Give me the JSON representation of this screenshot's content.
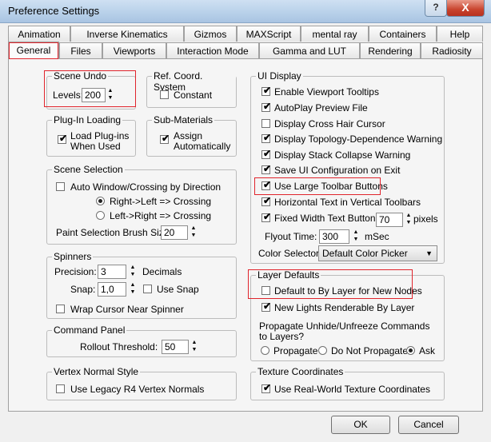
{
  "window": {
    "title": "Preference Settings",
    "help": "?",
    "close": "X"
  },
  "tabs_row1": [
    "Animation",
    "Inverse Kinematics",
    "Gizmos",
    "MAXScript",
    "mental ray",
    "Containers",
    "Help"
  ],
  "tabs_row2": [
    "General",
    "Files",
    "Viewports",
    "Interaction Mode",
    "Gamma and LUT",
    "Rendering",
    "Radiosity"
  ],
  "scene_undo": {
    "title": "Scene Undo",
    "levels_label": "Levels:",
    "levels_value": "200"
  },
  "ref_coord": {
    "title": "Ref. Coord. System",
    "constant": "Constant"
  },
  "plugin_loading": {
    "title": "Plug-In Loading",
    "load_line1": "Load Plug-ins",
    "load_line2": "When Used"
  },
  "sub_materials": {
    "title": "Sub-Materials",
    "assign_line1": "Assign",
    "assign_line2": "Automatically"
  },
  "scene_selection": {
    "title": "Scene Selection",
    "auto_window": "Auto Window/Crossing by Direction",
    "right_left": "Right->Left => Crossing",
    "left_right": "Left->Right => Crossing",
    "brush_label": "Paint Selection Brush Size",
    "brush_value": "20"
  },
  "spinners": {
    "title": "Spinners",
    "precision_label": "Precision:",
    "precision_value": "3",
    "decimals": "Decimals",
    "snap_label": "Snap:",
    "snap_value": "1,0",
    "use_snap": "Use Snap",
    "wrap_cursor": "Wrap Cursor Near Spinner"
  },
  "command_panel": {
    "title": "Command Panel",
    "rollout_label": "Rollout Threshold:",
    "rollout_value": "50"
  },
  "vertex_normal": {
    "title": "Vertex Normal Style",
    "legacy": "Use Legacy R4 Vertex Normals"
  },
  "ui_display": {
    "title": "UI Display",
    "items": [
      "Enable Viewport Tooltips",
      "AutoPlay Preview File",
      "Display Cross Hair Cursor",
      "Display Topology-Dependence Warning",
      "Display Stack Collapse Warning",
      "Save UI Configuration on Exit",
      "Use Large Toolbar Buttons",
      "Horizontal Text in Vertical Toolbars",
      "Fixed Width Text Buttons:"
    ],
    "fixed_width_value": "70",
    "pixels": "pixels",
    "flyout_label": "Flyout Time:",
    "flyout_value": "300",
    "msec": "mSec",
    "color_selector_label": "Color Selector:",
    "color_selector_value": "Default Color Picker"
  },
  "layer_defaults": {
    "title": "Layer Defaults",
    "default_by_layer": "Default to By Layer for New Nodes",
    "new_lights": "New Lights Renderable By Layer",
    "propagate_line1": "Propagate Unhide/Unfreeze Commands",
    "propagate_line2": "to Layers?",
    "propagate": "Propagate",
    "do_not_propagate": "Do Not Propagate",
    "ask": "Ask"
  },
  "texture_coords": {
    "title": "Texture Coordinates",
    "real_world": "Use Real-World Texture Coordinates"
  },
  "buttons": {
    "ok": "OK",
    "cancel": "Cancel"
  },
  "check": "✔",
  "colors": {
    "highlight": "#e0242c",
    "close": "#c8432d"
  }
}
